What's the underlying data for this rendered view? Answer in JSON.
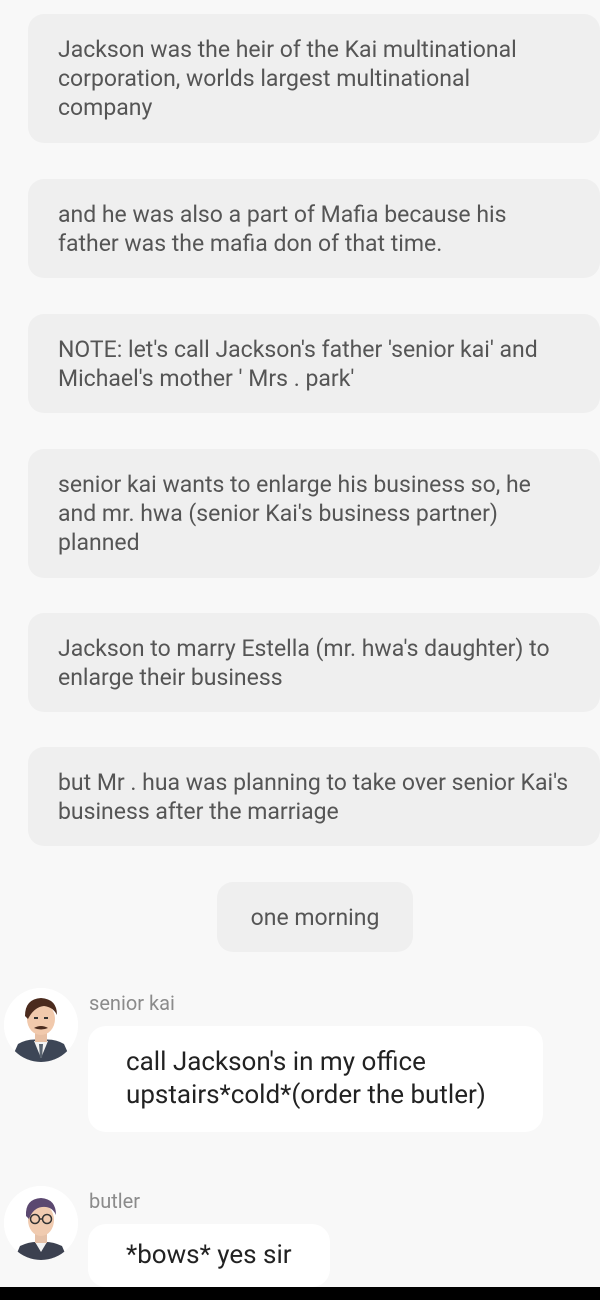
{
  "story": {
    "narrations": [
      "Jackson was the heir of the Kai multinational corporation, worlds largest multinational company",
      "and he was also a part of Mafia because his father was the mafia don of that time.",
      "NOTE: let's call Jackson's father 'senior kai' and Michael's mother ' Mrs . park'",
      "senior kai wants to enlarge his business so, he and mr. hwa (senior Kai's business partner) planned",
      "Jackson to marry Estella (mr. hwa's daughter) to enlarge their business",
      "but Mr . hua was planning to take over senior Kai's business after the marriage"
    ],
    "scene_note": "one morning",
    "messages": [
      {
        "speaker": "senior kai",
        "text": "call Jackson's in my office upstairs*cold*(order the butler)",
        "avatar_icon": "senior-kai-avatar-icon"
      },
      {
        "speaker": "butler",
        "text": "*bows* yes sir",
        "avatar_icon": "butler-avatar-icon"
      }
    ]
  },
  "colors": {
    "background": "#f8f8f8",
    "narration_bg": "#efefef",
    "bubble_bg": "#ffffff"
  }
}
